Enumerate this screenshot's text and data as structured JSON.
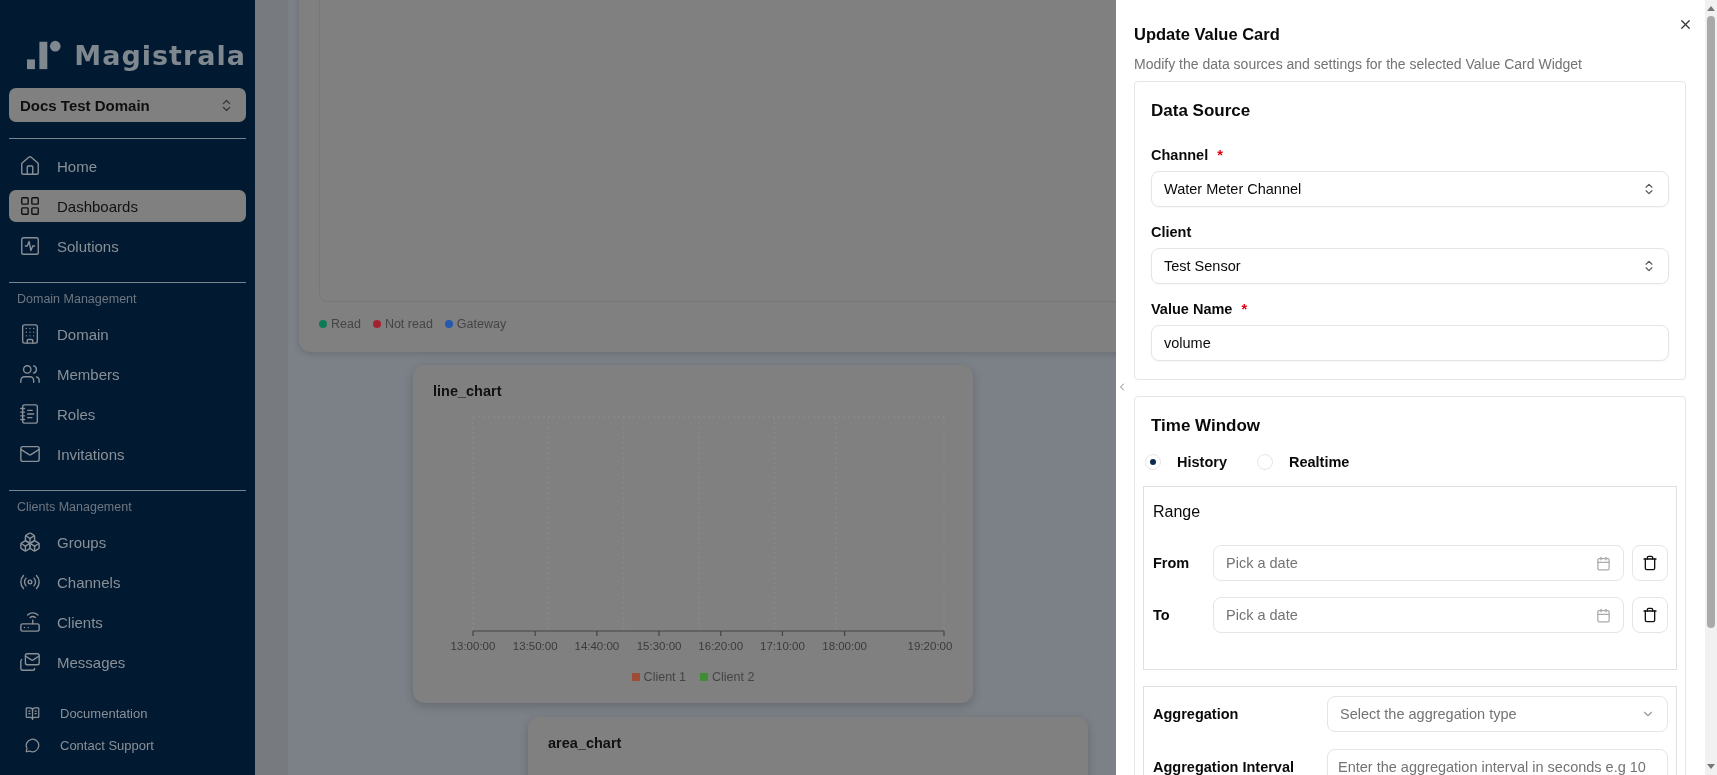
{
  "sidebar": {
    "logo": "Magistrala",
    "domain_selector": "Docs Test Domain",
    "sections": [
      {
        "items": [
          {
            "label": "Home",
            "selected": false
          },
          {
            "label": "Dashboards",
            "selected": true
          },
          {
            "label": "Solutions",
            "selected": false
          }
        ]
      },
      {
        "heading": "Domain Management",
        "items": [
          {
            "label": "Domain",
            "selected": false
          },
          {
            "label": "Members",
            "selected": false
          },
          {
            "label": "Roles",
            "selected": false
          },
          {
            "label": "Invitations",
            "selected": false
          }
        ]
      },
      {
        "heading": "Clients Management",
        "items": [
          {
            "label": "Groups",
            "selected": false
          },
          {
            "label": "Channels",
            "selected": false
          },
          {
            "label": "Clients",
            "selected": false
          },
          {
            "label": "Messages",
            "selected": false
          }
        ]
      }
    ],
    "footer_links": [
      "Documentation",
      "Contact Support"
    ]
  },
  "dashboard": {
    "top_widget": {
      "legend": [
        {
          "label": "Read",
          "color": "#0e7a55"
        },
        {
          "label": "Not read",
          "color": "#a3222f"
        },
        {
          "label": "Gateway",
          "color": "#2559ae"
        }
      ]
    },
    "line_chart": {
      "title": "line_chart",
      "x_labels": [
        "13:00:00",
        "13:50:00",
        "14:40:00",
        "15:30:00",
        "16:20:00",
        "17:10:00",
        "18:00:00",
        "19:20:00"
      ],
      "legend": [
        {
          "label": "Client 1",
          "color": "#a04b33"
        },
        {
          "label": "Client 2",
          "color": "#3f8f32"
        }
      ]
    },
    "area_chart": {
      "title": "area_chart"
    }
  },
  "drawer": {
    "title": "Update Value Card",
    "subtitle": "Modify the data sources and settings for the selected Value Card Widget",
    "data_source": {
      "title": "Data Source",
      "fields": [
        {
          "kind": "select",
          "label": "Channel",
          "required_mark": "*",
          "value": "Water Meter Channel"
        },
        {
          "kind": "select",
          "label": "Client",
          "value": "Test Sensor"
        },
        {
          "kind": "input",
          "label": "Value Name",
          "required_mark": "*",
          "value": "volume"
        }
      ]
    },
    "time_window": {
      "title": "Time Window",
      "modes": [
        {
          "label": "History",
          "selected": true
        },
        {
          "label": "Realtime",
          "selected": false
        }
      ],
      "range": {
        "title": "Range",
        "rows": [
          {
            "label": "From",
            "placeholder": "Pick a date"
          },
          {
            "label": "To",
            "placeholder": "Pick a date"
          }
        ]
      },
      "aggregation": {
        "label": "Aggregation",
        "placeholder": "Select the aggregation type"
      },
      "aggregation_interval": {
        "label": "Aggregation Interval",
        "placeholder": "Enter the aggregation interval in seconds e.g 10"
      }
    }
  }
}
